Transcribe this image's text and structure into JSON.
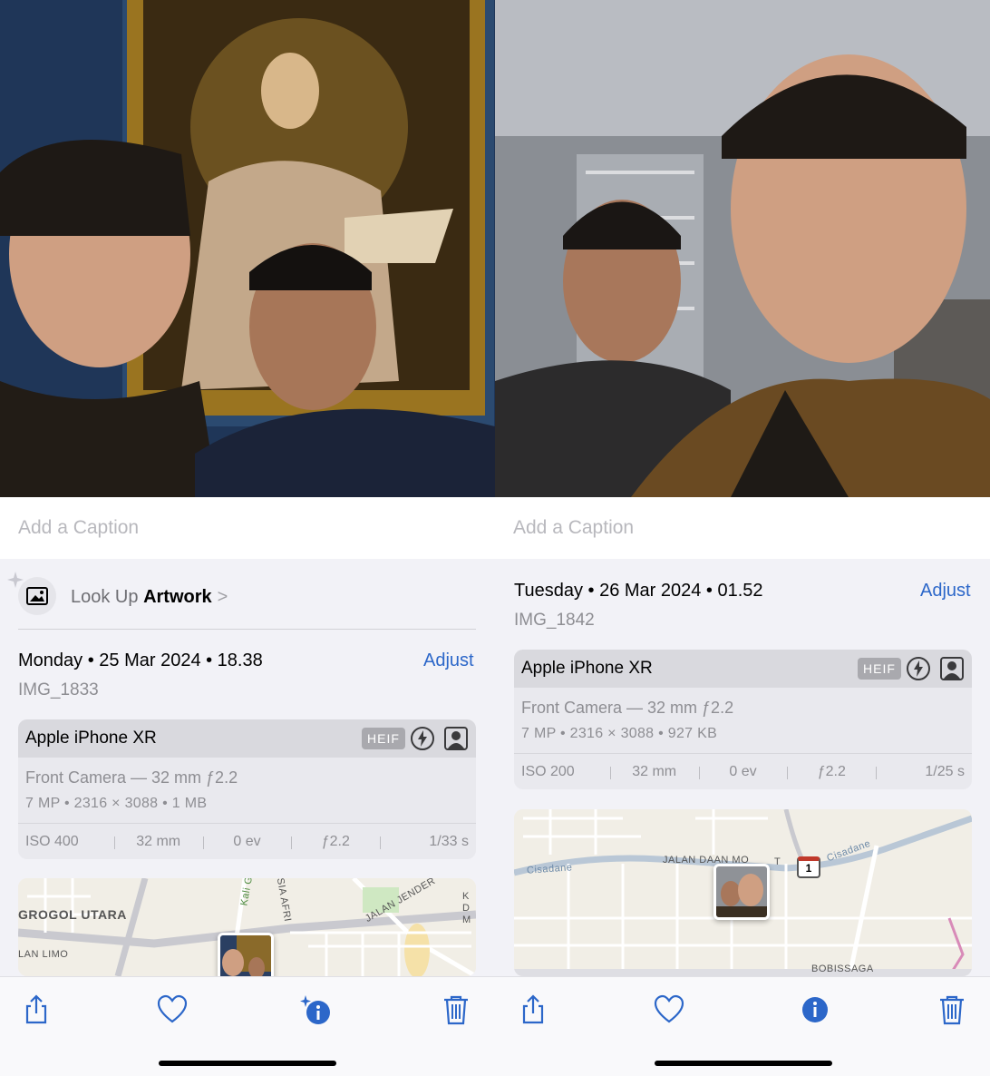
{
  "left": {
    "caption_placeholder": "Add a Caption",
    "lookup": {
      "prefix": "Look Up",
      "subject": "Artwork",
      "chevron": ">"
    },
    "date": "Monday • 25 Mar 2024 • 18.38",
    "adjust": "Adjust",
    "filename": "IMG_1833",
    "exif": {
      "device": "Apple iPhone XR",
      "format": "HEIF",
      "lens": "Front Camera — 32 mm ƒ2.2",
      "specs": "7 MP  •  2316 × 3088  •  1 MB",
      "iso": "ISO 400",
      "focal": "32 mm",
      "ev": "0 ev",
      "aperture": "ƒ2.2",
      "shutter": "1/33 s"
    },
    "map_labels": [
      "GROGOL UTARA",
      "LAN LIMO",
      "Kali Gr",
      "ASIA AFRI",
      "JALAN JENDER",
      "K D M"
    ]
  },
  "right": {
    "caption_placeholder": "Add a Caption",
    "date": "Tuesday • 26 Mar 2024 • 01.52",
    "adjust": "Adjust",
    "filename": "IMG_1842",
    "exif": {
      "device": "Apple iPhone XR",
      "format": "HEIF",
      "lens": "Front Camera — 32 mm ƒ2.2",
      "specs": "7 MP  •  2316 × 3088  •  927 KB",
      "iso": "ISO 200",
      "focal": "32 mm",
      "ev": "0 ev",
      "aperture": "ƒ2.2",
      "shutter": "1/25 s"
    },
    "map_labels": [
      "Cisadane",
      "JALAN DAAN MO",
      "T",
      "Cisadane",
      "BOBISSAGA"
    ],
    "route_badge": "1"
  },
  "toolbar": {
    "icons": [
      "share-icon",
      "heart-icon",
      "info-icon",
      "trash-icon"
    ]
  },
  "colors": {
    "accent": "#2c67c9",
    "secondary_text": "#8e8e93",
    "background": "#f2f2f7"
  }
}
